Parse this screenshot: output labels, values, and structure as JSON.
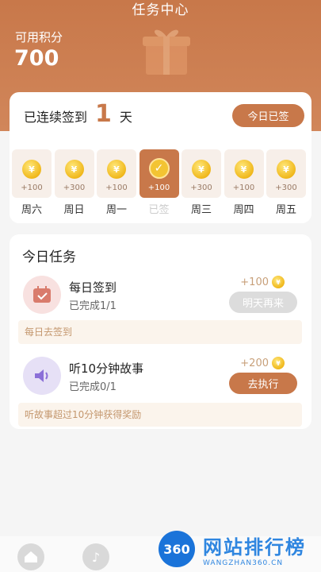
{
  "header": {
    "title": "任务中心",
    "points_label": "可用积分",
    "points_value": "700"
  },
  "checkin": {
    "streak_prefix": "已连续签到",
    "streak_days": "1",
    "streak_suffix": "天",
    "signed_label": "今日已签",
    "days": [
      {
        "points": "+100",
        "label": "周六",
        "active": false
      },
      {
        "points": "+300",
        "label": "周日",
        "active": false
      },
      {
        "points": "+100",
        "label": "周一",
        "active": false
      },
      {
        "points": "+100",
        "label": "已签",
        "active": true
      },
      {
        "points": "+300",
        "label": "周三",
        "active": false
      },
      {
        "points": "+100",
        "label": "周四",
        "active": false
      },
      {
        "points": "+300",
        "label": "周五",
        "active": false
      }
    ]
  },
  "tasks": {
    "title": "今日任务",
    "items": [
      {
        "name": "每日签到",
        "status": "已完成1/1",
        "reward": "+100",
        "button": "明天再来",
        "hint": "每日去签到",
        "button_color": "#dcdcdc",
        "icon": "calendar-icon"
      },
      {
        "name": "听10分钟故事",
        "status": "已完成0/1",
        "reward": "+200",
        "button": "去执行",
        "hint": "听故事超过10分钟获得奖励",
        "button_color": "#c8784a",
        "icon": "speaker-icon"
      }
    ]
  },
  "coin_symbol": "¥",
  "watermark": {
    "logo": "360",
    "title": "网站排行榜",
    "subtitle": "WANGZHAN360.CN"
  },
  "colors": {
    "accent": "#c8784a",
    "coin": "#f0b81c"
  }
}
